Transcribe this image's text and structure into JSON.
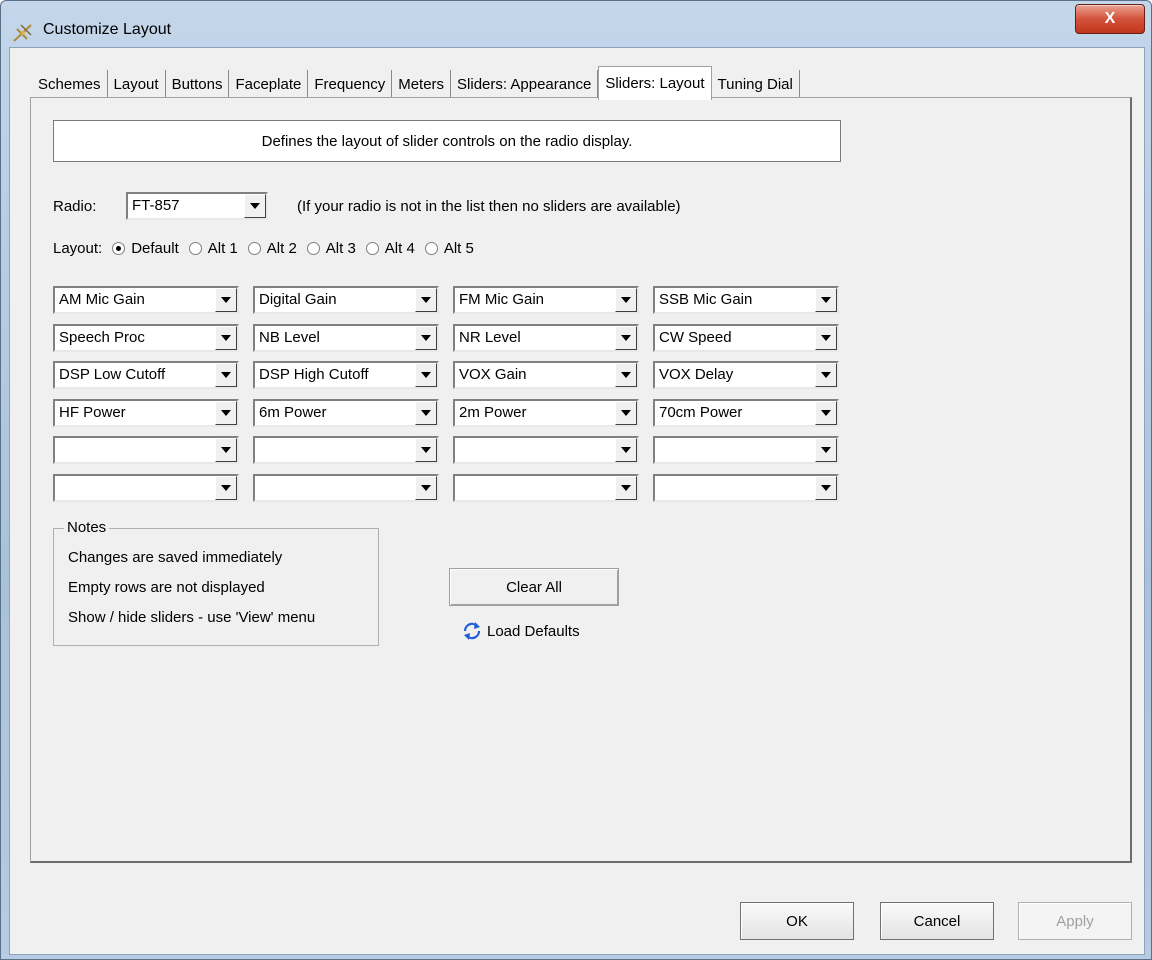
{
  "window": {
    "title": "Customize Layout",
    "close_label": "X"
  },
  "tabs": [
    {
      "label": "Schemes",
      "active": false
    },
    {
      "label": "Layout",
      "active": false
    },
    {
      "label": "Buttons",
      "active": false
    },
    {
      "label": "Faceplate",
      "active": false
    },
    {
      "label": "Frequency",
      "active": false
    },
    {
      "label": "Meters",
      "active": false
    },
    {
      "label": "Sliders: Appearance",
      "active": false
    },
    {
      "label": "Sliders: Layout",
      "active": true
    },
    {
      "label": "Tuning Dial",
      "active": false
    }
  ],
  "description": "Defines the layout of slider controls on the radio display.",
  "radio": {
    "label": "Radio:",
    "value": "FT-857",
    "hint": "(If your radio is not in the list then no sliders are available)"
  },
  "layout": {
    "label": "Layout:",
    "options": [
      "Default",
      "Alt 1",
      "Alt 2",
      "Alt 3",
      "Alt 4",
      "Alt 5"
    ],
    "selected": "Default"
  },
  "slider_grid": [
    [
      "AM Mic Gain",
      "Digital Gain",
      "FM Mic Gain",
      "SSB Mic Gain"
    ],
    [
      "Speech Proc",
      "NB Level",
      "NR Level",
      "CW Speed"
    ],
    [
      "DSP Low Cutoff",
      "DSP High Cutoff",
      "VOX Gain",
      "VOX Delay"
    ],
    [
      "HF Power",
      "6m Power",
      "2m Power",
      "70cm Power"
    ],
    [
      "",
      "",
      "",
      ""
    ],
    [
      "",
      "",
      "",
      ""
    ]
  ],
  "notes": {
    "title": "Notes",
    "lines": [
      "Changes are saved immediately",
      "Empty rows are not displayed",
      "Show / hide sliders - use 'View' menu"
    ]
  },
  "buttons": {
    "clear_all": "Clear All",
    "load_defaults": "Load Defaults",
    "ok": "OK",
    "cancel": "Cancel",
    "apply": "Apply",
    "apply_enabled": false
  },
  "icons": {
    "app": "antenna-icon",
    "reload": "refresh-icon",
    "dropdown": "chevron-down-icon"
  },
  "colors": {
    "dialog_bg": "#f0f0f0",
    "close_button": "#c7462c",
    "refresh_icon": "#1f5fd6"
  }
}
